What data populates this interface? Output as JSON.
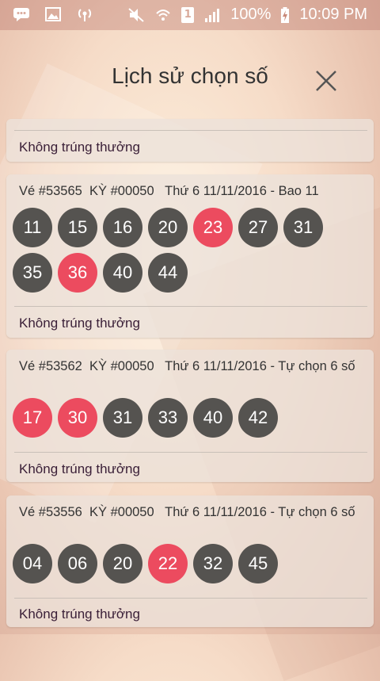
{
  "status_bar": {
    "battery": "100%",
    "time": "10:09 PM",
    "sim_number": "1",
    "icons": [
      "chat-icon",
      "image-icon",
      "hotspot-icon",
      "mute-icon",
      "wifi-icon",
      "sim-icon",
      "signal-icon",
      "battery-charging-icon"
    ]
  },
  "header": {
    "title": "Lịch sử chọn số",
    "close_icon": "close-icon"
  },
  "top_card": {
    "result": "Không trúng thưởng"
  },
  "tickets": [
    {
      "ticket": "Vé #53565",
      "ky": "KỲ #00050",
      "date": "Thứ 6 11/11/2016 - Bao 11",
      "numbers": [
        "11",
        "15",
        "16",
        "20",
        "23",
        "27",
        "31",
        "35",
        "36",
        "40",
        "44"
      ],
      "hits": [
        "23",
        "36"
      ],
      "result": "Không trúng thưởng"
    },
    {
      "ticket": "Vé #53562",
      "ky": "KỲ #00050",
      "date": "Thứ 6 11/11/2016 - Tự chọn 6 số",
      "numbers": [
        "17",
        "30",
        "31",
        "33",
        "40",
        "42"
      ],
      "hits": [
        "17",
        "30"
      ],
      "result": "Không trúng thưởng"
    },
    {
      "ticket": "Vé #53556",
      "ky": "KỲ #00050",
      "date": "Thứ 6 11/11/2016 - Tự chọn 6 số",
      "numbers": [
        "04",
        "06",
        "20",
        "22",
        "32",
        "45"
      ],
      "hits": [
        "22"
      ],
      "result": "Không trúng thưởng"
    }
  ],
  "colors": {
    "hit_ball": "#ec4b5f",
    "ball": "#555350",
    "result_text": "#3b2038"
  }
}
